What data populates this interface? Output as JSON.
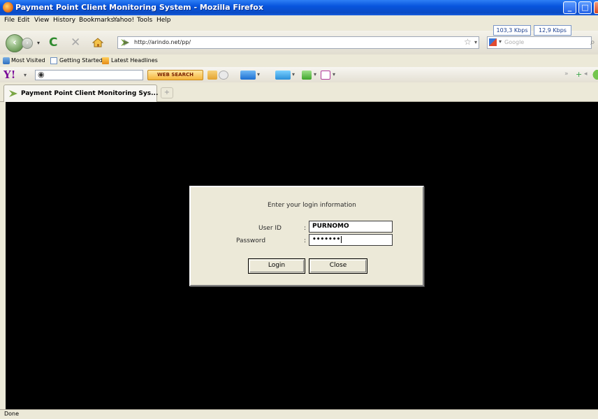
{
  "window": {
    "title": "Payment Point Client Monitoring System - Mozilla Firefox"
  },
  "menu": [
    "File",
    "Edit",
    "View",
    "History",
    "Bookmarks",
    "Yahoo!",
    "Tools",
    "Help"
  ],
  "speed": {
    "download": "103,3 Kbps",
    "upload": "12,9 Kbps"
  },
  "nav": {
    "url": "http://arindo.net/pp/",
    "search_placeholder": "Google"
  },
  "bookmarks": [
    "Most Visited",
    "Getting Started",
    "Latest Headlines"
  ],
  "yahoo_toolbar": {
    "logo": "Y!",
    "search_button": "WEB SEARCH"
  },
  "tab": {
    "title": "Payment Point Client Monitoring Sys...",
    "new_tab": "+"
  },
  "dialog": {
    "heading": "Enter your login information",
    "user_label": "User ID",
    "user_value": "PURNOMO",
    "password_label": "Password",
    "password_value": "•••••••",
    "login_button": "Login",
    "close_button": "Close"
  },
  "status": "Done",
  "colors": {
    "titlebar": "#0a4bc4",
    "content_bg": "#000000",
    "dialog_bg": "#ece9d8"
  }
}
